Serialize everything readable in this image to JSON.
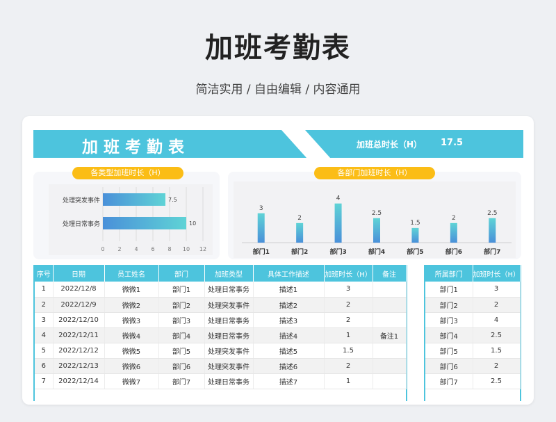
{
  "header": {
    "title": "加班考勤表",
    "subtitle": "简洁实用 / 自由编辑 / 内容通用"
  },
  "banner": {
    "title": "加班考勤表",
    "total_label": "加班总时长（H）",
    "total_value": "17.5"
  },
  "colors": {
    "accent": "#4dc4dd",
    "pill": "#fbbd16",
    "bar_top": "#5fd3d6",
    "bar_bottom": "#4a90d9"
  },
  "chart_data": [
    {
      "type": "bar",
      "orientation": "horizontal",
      "title": "各类型加班时长（H）",
      "categories": [
        "处理突发事件",
        "处理日常事务"
      ],
      "values": [
        7.5,
        10
      ],
      "xlim": [
        0,
        12
      ],
      "xticks": [
        "0",
        "2",
        "4",
        "6",
        "8",
        "10",
        "12"
      ],
      "data_labels": [
        "7.5",
        "10"
      ],
      "grid": true
    },
    {
      "type": "bar",
      "orientation": "vertical",
      "title": "各部门加班时长（H）",
      "categories": [
        "部门1",
        "部门2",
        "部门3",
        "部门4",
        "部门5",
        "部门6",
        "部门7"
      ],
      "values": [
        3,
        2,
        4,
        2.5,
        1.5,
        2,
        2.5
      ],
      "data_labels": [
        "3",
        "2",
        "4",
        "2.5",
        "1.5",
        "2",
        "2.5"
      ],
      "ylim": [
        0,
        5
      ]
    }
  ],
  "main_table": {
    "headers": [
      "序号",
      "日期",
      "员工姓名",
      "部门",
      "加班类型",
      "具体工作描述",
      "加班时长（H）",
      "备注"
    ],
    "rows": [
      [
        "1",
        "2022/12/8",
        "微微1",
        "部门1",
        "处理日常事务",
        "描述1",
        "3",
        ""
      ],
      [
        "2",
        "2022/12/9",
        "微微2",
        "部门2",
        "处理突发事件",
        "描述2",
        "2",
        ""
      ],
      [
        "3",
        "2022/12/10",
        "微微3",
        "部门3",
        "处理日常事务",
        "描述3",
        "2",
        ""
      ],
      [
        "4",
        "2022/12/11",
        "微微4",
        "部门4",
        "处理日常事务",
        "描述4",
        "1",
        "备注1"
      ],
      [
        "5",
        "2022/12/12",
        "微微5",
        "部门5",
        "处理突发事件",
        "描述5",
        "1.5",
        ""
      ],
      [
        "6",
        "2022/12/13",
        "微微6",
        "部门6",
        "处理突发事件",
        "描述6",
        "2",
        ""
      ],
      [
        "7",
        "2022/12/14",
        "微微7",
        "部门7",
        "处理日常事务",
        "描述7",
        "1",
        ""
      ]
    ]
  },
  "side_table": {
    "headers": [
      "所属部门",
      "加班时长（H）"
    ],
    "rows": [
      [
        "部门1",
        "3"
      ],
      [
        "部门2",
        "2"
      ],
      [
        "部门3",
        "4"
      ],
      [
        "部门4",
        "2.5"
      ],
      [
        "部门5",
        "1.5"
      ],
      [
        "部门6",
        "2"
      ],
      [
        "部门7",
        "2.5"
      ]
    ]
  }
}
